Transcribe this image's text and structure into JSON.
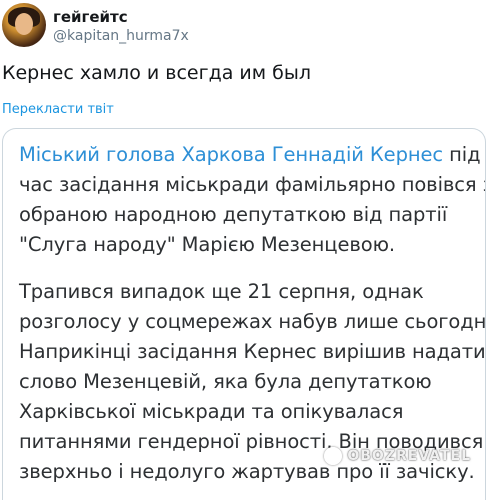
{
  "author": {
    "display_name": "гейгейтс",
    "username": "@kapitan_hurma7x",
    "avatar_icon": "profile-avatar"
  },
  "tweet": {
    "text": "Кернес хамло и всегда им был",
    "translate_label": "Перекласти твіт"
  },
  "article": {
    "lead_link": "Міський голова Харкова Геннадій Кернес",
    "lines": [
      "під",
      "час засідання міськради фамільярно повівся з",
      "обраною народною депутаткою від партії",
      "\"Слуга народу\" Марією Мезенцевою.",
      "Трапився випадок ще 21 серпня, однак",
      "розголосу у соцмережах набув лише сьогодні.",
      "Наприкінці засідання Кернес вирішив надати",
      "слово Мезенцевій, яка була депутаткою",
      "Харківської міськради та опікувалася",
      "питаннями гендерної рівності. Він поводився",
      "зверхньо і недолуго жартував про її зачіску."
    ]
  },
  "watermark": {
    "text": "OBOZREVATEL",
    "icon": "obozrevatel-logo-icon"
  },
  "colors": {
    "link": "#1b95e0",
    "article_link": "#2d8fd6",
    "text": "#14171a",
    "muted": "#657786",
    "border": "#ccd6dd"
  }
}
